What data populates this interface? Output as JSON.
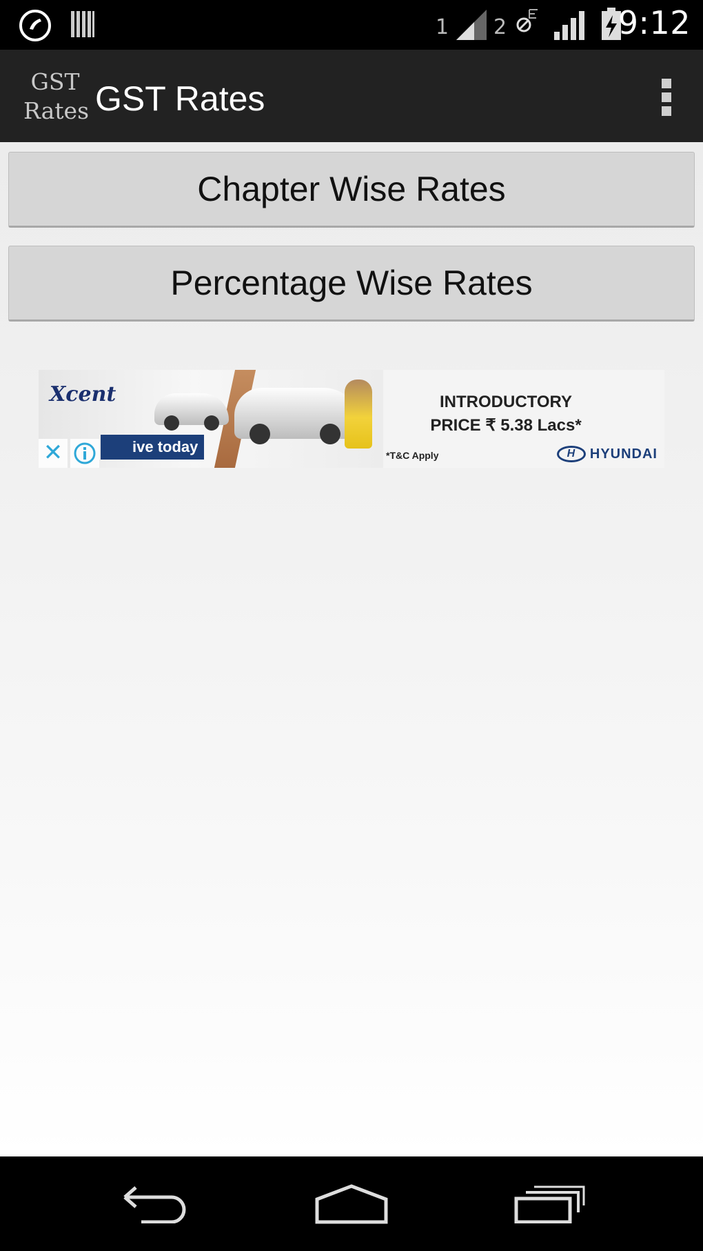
{
  "status_bar": {
    "time": "9:12",
    "sim1_label": "1",
    "sim2_label": "2",
    "icons": [
      "call-icon",
      "barcode-icon",
      "signal-icon",
      "dnd-icon",
      "signal-icon",
      "battery-charging-icon"
    ]
  },
  "action_bar": {
    "logo_line1": "GST",
    "logo_line2": "Rates",
    "title": "GST Rates",
    "overflow_icon": "overflow-menu-icon"
  },
  "main": {
    "buttons": [
      {
        "label": "Chapter Wise Rates"
      },
      {
        "label": "Percentage Wise Rates"
      }
    ]
  },
  "ad": {
    "brand": "Xcent",
    "cta": "ive today",
    "headline_line1": "INTRODUCTORY",
    "headline_line2": "PRICE ₹ 5.38 Lacs*",
    "terms": "*T&C Apply",
    "maker": "HYUNDAI",
    "close_symbol": "✕"
  },
  "nav_bar": {
    "icons": [
      "back-icon",
      "home-icon",
      "recents-icon"
    ]
  },
  "colors": {
    "status_bar": "#000000",
    "action_bar": "#222222",
    "button_bg": "#d6d6d6",
    "ad_accent": "#1c3f7a"
  }
}
